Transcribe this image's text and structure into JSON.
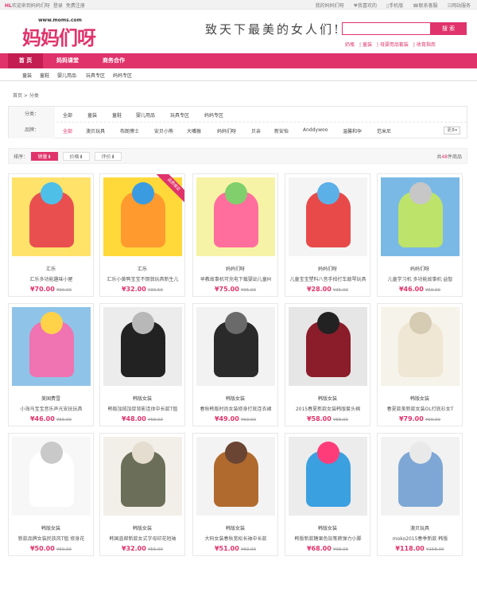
{
  "topbar": {
    "brand": "HL",
    "welcome": "欢迎来到妈妈们呀",
    "login": "登录",
    "register": "免费注册",
    "right_links": [
      "我的妈妈们呀",
      "我喜欢的",
      "手机版",
      "联系客服",
      "网站服务"
    ]
  },
  "header": {
    "logo_url": "www.moms.com",
    "logo_text": "妈妈们呀",
    "slogan": "致天下最美的女人们!",
    "search_placeholder": "",
    "search_button": "搜 索",
    "hot_links": [
      "奶瓶",
      "童装",
      "母婴用品套装",
      "收育指南"
    ]
  },
  "nav": {
    "items": [
      "首 页",
      "妈妈课堂",
      "商务合作"
    ]
  },
  "subnav": {
    "items": [
      "童装",
      "童鞋",
      "婴儿用品",
      "玩具专区",
      "妈妈专区"
    ]
  },
  "breadcrumb": "首页 > 分类",
  "filters": {
    "category_label": "分类：",
    "categories": [
      "全部",
      "童装",
      "童鞋",
      "婴儿用品",
      "玩具专区",
      "妈妈专区"
    ],
    "brand_label": "品牌：",
    "brands": [
      "全部",
      "澳贝玩具",
      "布朗博士",
      "安贝小熊",
      "大嘴猴",
      "妈妈们呀",
      "贝亲",
      "新安怡",
      "Anddywoo",
      "温馨和孕",
      "范米尼"
    ],
    "more": "更多"
  },
  "sort": {
    "label": "排序：",
    "options": [
      "销量",
      "价格",
      "评价"
    ],
    "count_prefix": "共",
    "count": "48",
    "count_suffix": "件商品"
  },
  "products": [
    {
      "brand": "汇乐",
      "title": "汇乐多功能趣味小屋",
      "price": "¥70.00",
      "old": "¥90.00"
    },
    {
      "brand": "汇乐",
      "title": "汇乐小黄鸭宝宝不倒翁玩具新生儿",
      "price": "¥32.00",
      "old": "¥39.50",
      "ribbon": "品质保证"
    },
    {
      "brand": "妈妈们呀",
      "title": "早教故事机可充电下载婴幼儿童M",
      "price": "¥75.00",
      "old": "¥95.00"
    },
    {
      "brand": "妈妈们呀",
      "title": "儿童宝宝塑料八音手拍打车敲琴玩具",
      "price": "¥28.00",
      "old": "¥35.00"
    },
    {
      "brand": "妈妈们呀",
      "title": "儿童学习机 多功能故事机 益智",
      "price": "¥46.00",
      "old": "¥69.00"
    },
    {
      "brand": "美国费雪",
      "title": "小海马宝宝音乐声光安抚玩具",
      "price": "¥46.00",
      "old": "¥56.00"
    },
    {
      "brand": "韩版女装",
      "title": "韩版加绒加厚背影连体中长款T恤",
      "price": "¥48.00",
      "old": "¥68.00"
    },
    {
      "brand": "韩版女装",
      "title": "春秋韩版时尚女装修身打底连衣裙",
      "price": "¥49.00",
      "old": "¥69.00"
    },
    {
      "brand": "韩版女装",
      "title": "2015春夏新款女装韩版套头棉",
      "price": "¥58.00",
      "old": "¥88.00"
    },
    {
      "brand": "韩版女装",
      "title": "春夏款美新款女装OL打底衫女T",
      "price": "¥79.00",
      "old": "¥99.00"
    },
    {
      "brand": "韩版女装",
      "title": "新款品牌女装民族风T恤 修身花",
      "price": "¥50.00",
      "old": "¥69.00"
    },
    {
      "brand": "韩版女装",
      "title": "韩国直邮新款女式字母印花短袖",
      "price": "¥32.00",
      "old": "¥56.00"
    },
    {
      "brand": "韩版女装",
      "title": "大码女装春秋宽松长袖中长款",
      "price": "¥51.00",
      "old": "¥69.00"
    },
    {
      "brand": "韩版女装",
      "title": "韩版新款糖果色铅笔裤弹力小脚",
      "price": "¥68.00",
      "old": "¥98.00"
    },
    {
      "brand": "澳贝玩具",
      "title": "moko2015春季新款 韩版",
      "price": "¥118.00",
      "old": "¥158.00"
    }
  ],
  "colors": {
    "accent": "#e0336b",
    "nav_active": "#c31d52"
  }
}
